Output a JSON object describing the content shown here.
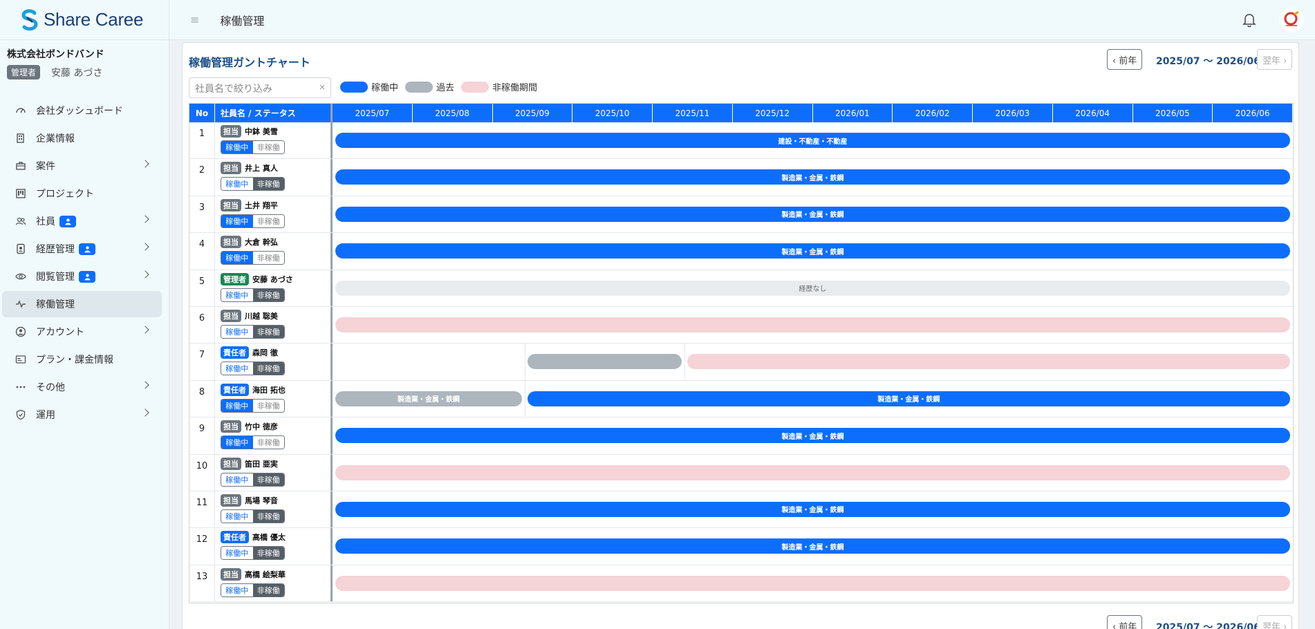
{
  "app": {
    "logo_text": "Share Caree",
    "page_title": "稼働管理"
  },
  "company": {
    "name": "株式会社ボンドバンド",
    "role_badge": "管理者",
    "user_name": "安藤 あづさ"
  },
  "nav": [
    {
      "label": "会社ダッシュボード",
      "icon": "speedometer-icon",
      "chevron": false,
      "badge": false,
      "active": false
    },
    {
      "label": "企業情報",
      "icon": "building-icon",
      "chevron": false,
      "badge": false,
      "active": false
    },
    {
      "label": "案件",
      "icon": "briefcase-icon",
      "chevron": true,
      "badge": false,
      "active": false
    },
    {
      "label": "プロジェクト",
      "icon": "kanban-icon",
      "chevron": false,
      "badge": false,
      "active": false
    },
    {
      "label": "社員",
      "icon": "people-icon",
      "chevron": true,
      "badge": true,
      "active": false
    },
    {
      "label": "経歴管理",
      "icon": "person-badge-icon",
      "chevron": true,
      "badge": true,
      "active": false
    },
    {
      "label": "閲覧管理",
      "icon": "eye-icon",
      "chevron": true,
      "badge": true,
      "active": false
    },
    {
      "label": "稼働管理",
      "icon": "activity-icon",
      "chevron": false,
      "badge": false,
      "active": true
    },
    {
      "label": "アカウント",
      "icon": "person-circle-icon",
      "chevron": true,
      "badge": false,
      "active": false
    },
    {
      "label": "プラン・課金情報",
      "icon": "card-icon",
      "chevron": false,
      "badge": false,
      "active": false
    },
    {
      "label": "その他",
      "icon": "dots-icon",
      "chevron": true,
      "badge": false,
      "active": false
    },
    {
      "label": "運用",
      "icon": "shield-icon",
      "chevron": true,
      "badge": false,
      "active": false
    }
  ],
  "card": {
    "title": "稼働管理ガントチャート",
    "prev_label": "‹ 前年",
    "next_label": "翌年 ›",
    "range": "2025/07 〜 2026/06",
    "filter_placeholder": "社員名で絞り込み",
    "filter_clear": "×"
  },
  "legend": [
    {
      "label": "稼働中",
      "color": "#0d6efd"
    },
    {
      "label": "過去",
      "color": "#adb5bd"
    },
    {
      "label": "非稼働期間",
      "color": "#f5d3d7"
    }
  ],
  "table": {
    "col_no": "No",
    "col_name": "社員名 / ステータス",
    "months": [
      "2025/07",
      "2025/08",
      "2025/09",
      "2025/10",
      "2025/11",
      "2025/12",
      "2026/01",
      "2026/02",
      "2026/03",
      "2026/04",
      "2026/05",
      "2026/06"
    ],
    "toggle_on": "稼働中",
    "toggle_off": "非稼働",
    "rows": [
      {
        "no": "1",
        "role": "担当",
        "role_type": "tanto",
        "name": "中鉢 美雪",
        "status": "on",
        "bars": [
          {
            "type": "active",
            "start": 0,
            "end": 12,
            "label": "建設・不動産・不動産"
          }
        ]
      },
      {
        "no": "2",
        "role": "担当",
        "role_type": "tanto",
        "name": "井上 真人",
        "status": "off",
        "bars": [
          {
            "type": "active",
            "start": 0,
            "end": 12,
            "label": "製造業・金属・鉄鋼"
          }
        ]
      },
      {
        "no": "3",
        "role": "担当",
        "role_type": "tanto",
        "name": "土井 翔平",
        "status": "on",
        "bars": [
          {
            "type": "active",
            "start": 0,
            "end": 12,
            "label": "製造業・金属・鉄鋼"
          }
        ]
      },
      {
        "no": "4",
        "role": "担当",
        "role_type": "tanto",
        "name": "大倉 幹弘",
        "status": "on",
        "bars": [
          {
            "type": "active",
            "start": 0,
            "end": 12,
            "label": "製造業・金属・鉄鋼"
          }
        ]
      },
      {
        "no": "5",
        "role": "管理者",
        "role_type": "kanri",
        "name": "安藤 あづさ",
        "status": "off",
        "bars": [
          {
            "type": "none",
            "start": 0,
            "end": 12,
            "label": "経歴なし"
          }
        ]
      },
      {
        "no": "6",
        "role": "担当",
        "role_type": "tanto",
        "name": "川越 聡美",
        "status": "off",
        "bars": [
          {
            "type": "inactive",
            "start": 0,
            "end": 12,
            "label": ""
          }
        ]
      },
      {
        "no": "7",
        "role": "責任者",
        "role_type": "sekinin",
        "name": "森岡 徹",
        "status": "off",
        "bars": [
          {
            "type": "past",
            "start": 2.4,
            "end": 4.4,
            "label": ""
          },
          {
            "type": "inactive",
            "start": 4.4,
            "end": 12,
            "label": ""
          }
        ],
        "vlines": [
          2.4,
          4.4
        ]
      },
      {
        "no": "8",
        "role": "責任者",
        "role_type": "sekinin",
        "name": "海田 拓也",
        "status": "on",
        "bars": [
          {
            "type": "past",
            "start": 0,
            "end": 2.4,
            "label": "製造業・金属・鉄鋼"
          },
          {
            "type": "active",
            "start": 2.4,
            "end": 12,
            "label": "製造業・金属・鉄鋼"
          }
        ],
        "vlines": [
          2.4
        ]
      },
      {
        "no": "9",
        "role": "担当",
        "role_type": "tanto",
        "name": "竹中 徳彦",
        "status": "on",
        "bars": [
          {
            "type": "active",
            "start": 0,
            "end": 12,
            "label": "製造業・金属・鉄鋼"
          }
        ]
      },
      {
        "no": "10",
        "role": "担当",
        "role_type": "tanto",
        "name": "笛田 亜実",
        "status": "off",
        "bars": [
          {
            "type": "inactive",
            "start": 0,
            "end": 12,
            "label": ""
          }
        ]
      },
      {
        "no": "11",
        "role": "担当",
        "role_type": "tanto",
        "name": "馬場 琴音",
        "status": "off",
        "bars": [
          {
            "type": "active",
            "start": 0,
            "end": 12,
            "label": "製造業・金属・鉄鋼"
          }
        ]
      },
      {
        "no": "12",
        "role": "責任者",
        "role_type": "sekinin",
        "name": "高橋 優太",
        "status": "off",
        "bars": [
          {
            "type": "active",
            "start": 0,
            "end": 12,
            "label": "製造業・金属・鉄鋼"
          }
        ]
      },
      {
        "no": "13",
        "role": "担当",
        "role_type": "tanto",
        "name": "高橋 絵梨華",
        "status": "off",
        "bars": [
          {
            "type": "inactive",
            "start": 0,
            "end": 12,
            "label": ""
          }
        ]
      }
    ]
  }
}
